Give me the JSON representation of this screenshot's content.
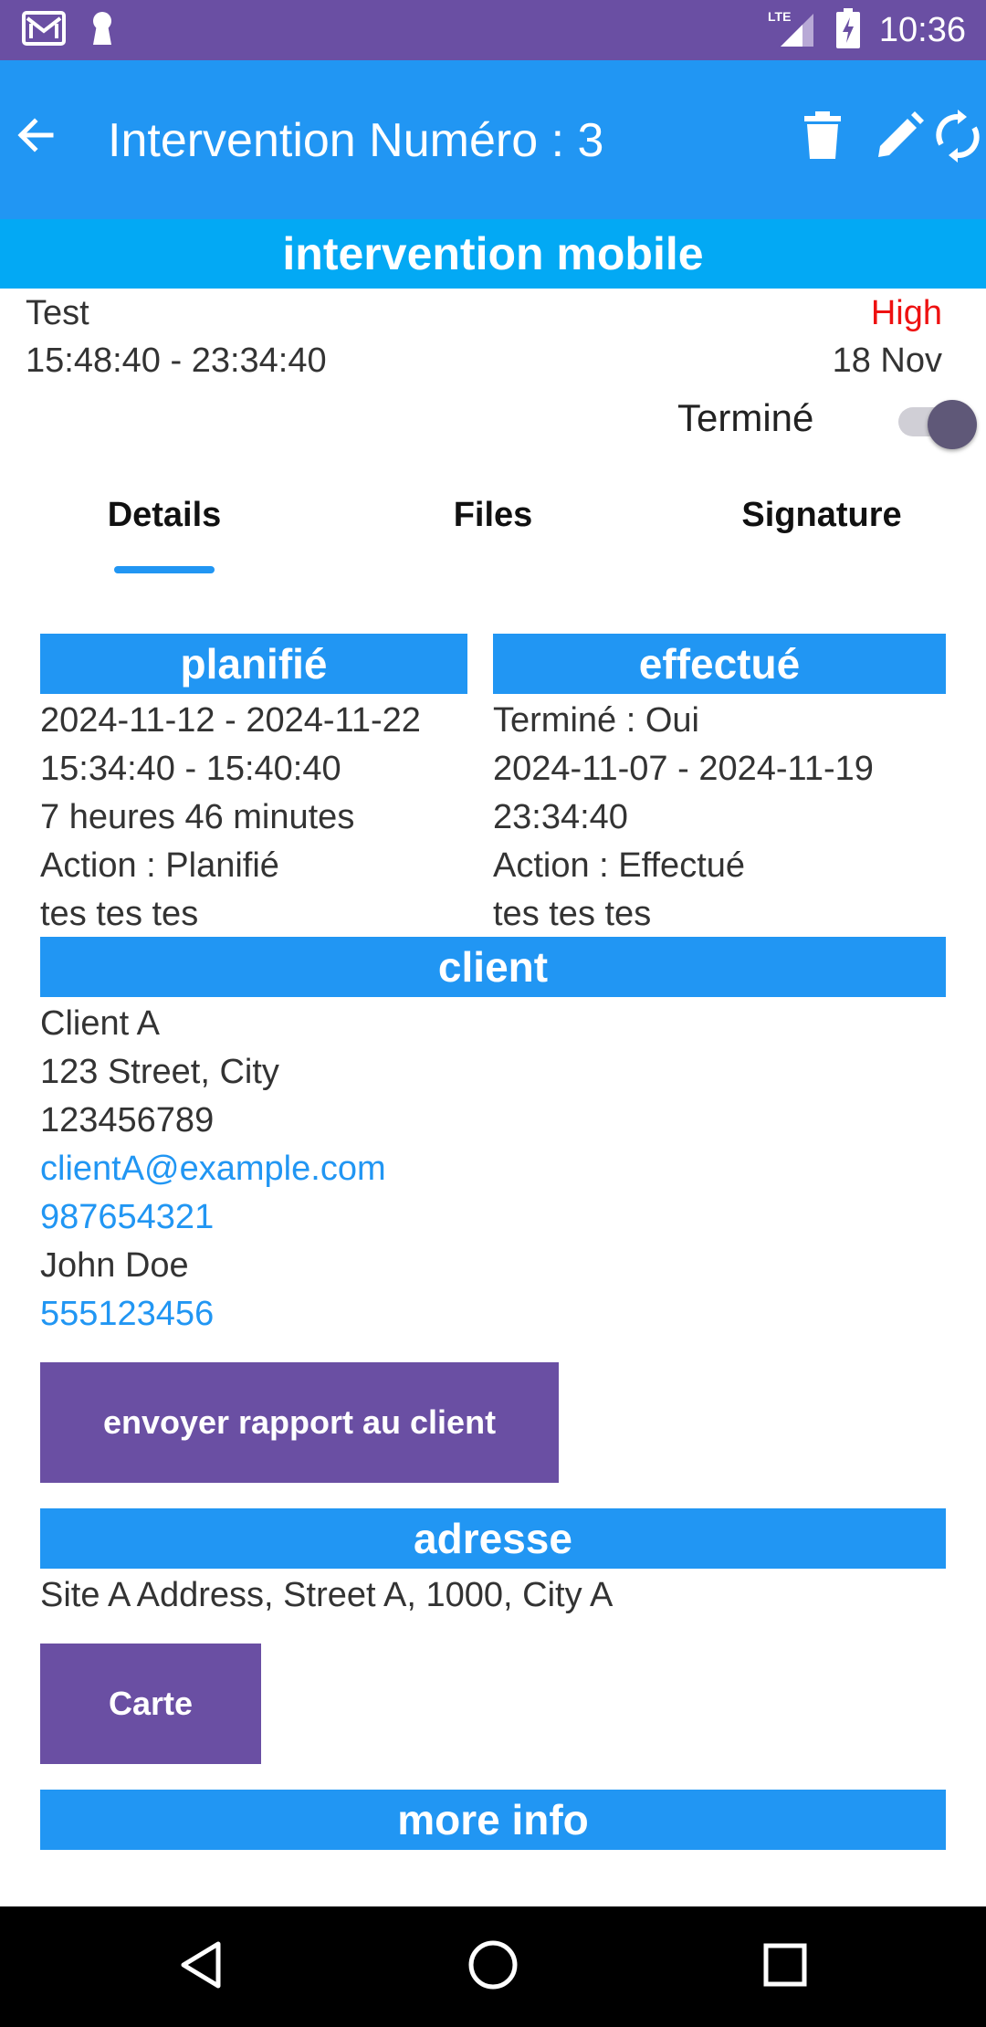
{
  "status_bar": {
    "time": "10:36",
    "network": "LTE",
    "icons": [
      "gmail-icon",
      "keyhole-icon",
      "signal-icon",
      "battery-charging-icon"
    ]
  },
  "app_bar": {
    "title": "Intervention Numéro : 3",
    "icons": [
      "back-arrow-icon",
      "delete-icon",
      "edit-icon",
      "sync-icon"
    ]
  },
  "banner": {
    "title": "intervention mobile"
  },
  "header": {
    "name": "Test",
    "time_range": "15:48:40 - 23:34:40",
    "priority": "High",
    "date": "18 Nov",
    "status_label": "Terminé",
    "status_on": true
  },
  "tabs": [
    {
      "label": "Details",
      "active": true
    },
    {
      "label": "Files",
      "active": false
    },
    {
      "label": "Signature",
      "active": false
    }
  ],
  "planned": {
    "title": "planifié",
    "lines": [
      "2024-11-12 - 2024-11-22",
      "15:34:40 - 15:40:40",
      "7 heures 46 minutes",
      "Action : Planifié",
      "tes tes tes"
    ]
  },
  "done": {
    "title": "effectué",
    "lines": [
      "Terminé : Oui",
      "2024-11-07 - 2024-11-19",
      "23:34:40",
      "Action : Effectué",
      "tes tes tes"
    ]
  },
  "client": {
    "title": "client",
    "name": "Client A",
    "address": "123 Street, City",
    "phone": "123456789",
    "email": "clientA@example.com",
    "mobile": "987654321",
    "contact_name": "John Doe",
    "contact_phone": "555123456",
    "send_report_label": "envoyer rapport au client"
  },
  "address": {
    "title": "adresse",
    "value": "Site A Address, Street A, 1000, City A",
    "map_label": "Carte"
  },
  "more_info": {
    "title": "more info"
  },
  "colors": {
    "status_bar": "#6a4fa3",
    "app_bar": "#2196f3",
    "banner": "#03a9f4",
    "button": "#6a4fa3",
    "priority": "#ee1111",
    "link": "#2196f3"
  }
}
